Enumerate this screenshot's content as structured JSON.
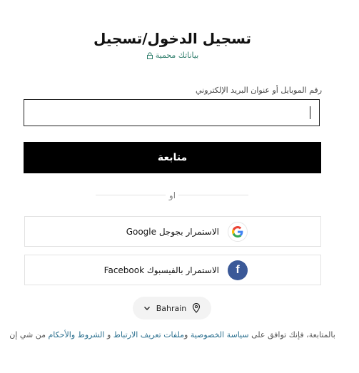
{
  "header": {
    "title": "تسجيل الدخول/تسجيل",
    "secure_note": "بياناتك محمية"
  },
  "form": {
    "field_label": "رقم الموبايل أو عنوان البريد الإلكتروني",
    "field_value": "",
    "continue_label": "متابعة",
    "or_label": "او"
  },
  "social": {
    "google_label": "الاستمرار بجوجل Google",
    "facebook_label": "الاستمرار بالفيسبوك Facebook"
  },
  "country": {
    "name": "Bahrain"
  },
  "terms": {
    "prefix": "بالمتابعة، فإنك توافق على ",
    "privacy_link": "سياسة الخصوصية",
    "and_word": " و",
    "cookies_link": "ملفات تعريف الارتباط",
    "and_word2": " و ",
    "terms_link": "الشروط والأحكام",
    "suffix": " من شي إن"
  },
  "colors": {
    "primary": "#000000",
    "secure_green": "#2e7d6b",
    "link_blue": "#2a6f8e",
    "facebook_blue": "#3b5998"
  }
}
